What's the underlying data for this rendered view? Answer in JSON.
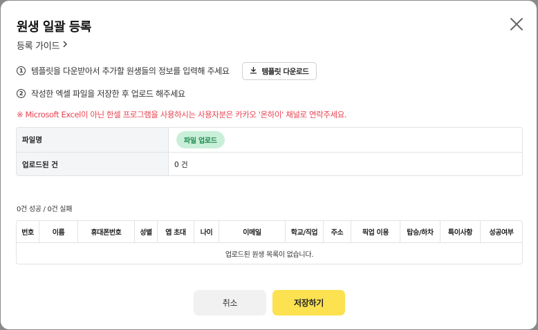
{
  "modal": {
    "title": "원생 일괄 등록",
    "guide_label": "등록 가이드",
    "steps": [
      {
        "num": "1",
        "text": "템플릿을 다운받아서 추가할 원생들의 정보를 입력해 주세요"
      },
      {
        "num": "2",
        "text": "작성한 엑셀 파일을 저장한 후 업로드 해주세요"
      }
    ],
    "template_button": "템플릿 다운로드",
    "notice": "※  Microsoft Excel이 아닌 한셀 프로그램을 사용하시는 사용자분은 카카오 '온하이' 채널로 연락주세요.",
    "info_table": {
      "file_label": "파일명",
      "upload_button": "파일 업로드",
      "uploaded_label": "업로드된 건",
      "uploaded_value": "0 건"
    },
    "result_summary": "0건 성공 / 0건 실패",
    "table": {
      "columns": [
        "번호",
        "이름",
        "휴대폰번호",
        "성별",
        "앱 초대",
        "나이",
        "이메일",
        "학교/직업",
        "주소",
        "픽업 이용",
        "탑승/하차",
        "특이사항",
        "성공여부"
      ],
      "empty_message": "업로드된 원생 목록이 없습니다."
    },
    "buttons": {
      "cancel": "취소",
      "save": "저장하기"
    }
  },
  "colors": {
    "accent_yellow": "#fce150",
    "notice_red": "#e8414f",
    "pill_green_bg": "#c9efd9",
    "pill_green_text": "#1f8a50"
  }
}
